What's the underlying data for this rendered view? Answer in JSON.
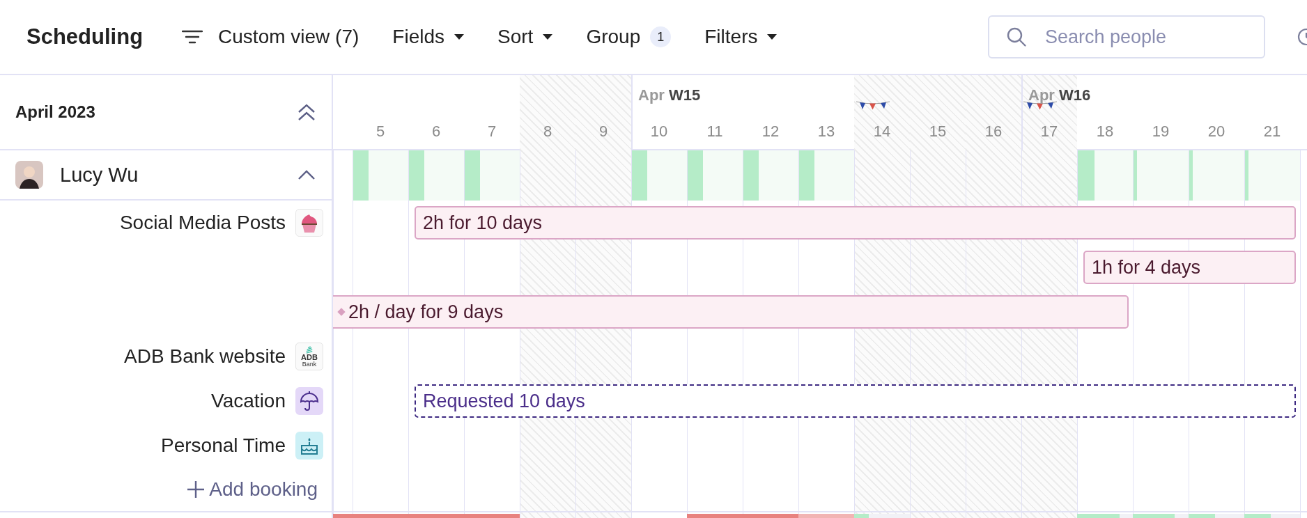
{
  "toolbar": {
    "title": "Scheduling",
    "view": {
      "label": "Custom view (7)"
    },
    "menus": [
      {
        "label": "Fields",
        "kind": "dropdown"
      },
      {
        "label": "Sort",
        "kind": "dropdown"
      },
      {
        "label": "Group",
        "kind": "count",
        "badge": "1"
      },
      {
        "label": "Filters",
        "kind": "dropdown"
      }
    ],
    "search": {
      "placeholder": "Search people"
    }
  },
  "sidebar": {
    "month": "April 2023",
    "person": {
      "name": "Lucy Wu",
      "expanded": true
    },
    "projects": [
      {
        "name": "Social Media Posts",
        "kind": "cupcake",
        "bookings": [
          {
            "label": "2h for 10 days",
            "kind": "confirmed",
            "continues_left": false
          },
          {
            "label": "1h for 4 days",
            "kind": "confirmed",
            "continues_left": false
          },
          {
            "label": "2h / day for 9 days",
            "kind": "confirmed",
            "continues_left": true
          }
        ]
      },
      {
        "name": "ADB Bank website",
        "kind": "logo",
        "logo_text": [
          "ADB",
          "Bank"
        ]
      },
      {
        "name": "Vacation",
        "kind": "umbrella",
        "bookings": [
          {
            "label": "Requested 10 days",
            "kind": "requested",
            "continues_left": false
          }
        ]
      },
      {
        "name": "Personal Time",
        "kind": "cake"
      }
    ],
    "add_label": "Add booking"
  },
  "weeks": [
    {
      "month": "Apr",
      "week": "W15"
    },
    {
      "month": "Apr",
      "week": "W16"
    }
  ],
  "days": [
    {
      "load": {
        "color": "#e8827f",
        "level": 1
      }
    },
    {
      "label": "5",
      "weekend": false,
      "level": 0.28,
      "load": {
        "color": "#e8827f",
        "level": 1
      }
    },
    {
      "label": "6",
      "weekend": false,
      "level": 0.28,
      "load": {
        "color": "#e8827f",
        "level": 1
      }
    },
    {
      "label": "7",
      "weekend": false,
      "level": 0.28,
      "load": {
        "color": "#e8827f",
        "level": 1
      }
    },
    {
      "label": "8",
      "weekend": true
    },
    {
      "label": "9",
      "weekend": true
    },
    {
      "label": "10",
      "weekend": false,
      "level": 0.28
    },
    {
      "label": "11",
      "weekend": false,
      "level": 0.28,
      "load": {
        "color": "#e8827f",
        "level": 1
      }
    },
    {
      "label": "12",
      "weekend": false,
      "level": 0.28,
      "load": {
        "color": "#e8827f",
        "level": 1
      }
    },
    {
      "label": "13",
      "weekend": false,
      "level": 0.28,
      "load": {
        "color": "#f2b4b3",
        "level": 1
      }
    },
    {
      "label": "14",
      "weekend": true,
      "holiday": true,
      "load": {
        "color": "#b5ecc8",
        "level": 0.26
      }
    },
    {
      "label": "15",
      "weekend": true
    },
    {
      "label": "16",
      "weekend": true
    },
    {
      "label": "17",
      "weekend": true,
      "holiday": true
    },
    {
      "label": "18",
      "weekend": false,
      "level": 0.3,
      "load": {
        "color": "#b5ecc8",
        "level": 0.76
      }
    },
    {
      "label": "19",
      "weekend": false,
      "level": 0.06,
      "load": {
        "color": "#b5ecc8",
        "level": 0.75
      }
    },
    {
      "label": "20",
      "weekend": false,
      "level": 0.06,
      "load": {
        "color": "#b5ecc8",
        "level": 0.48
      }
    },
    {
      "label": "21",
      "weekend": false,
      "level": 0.06,
      "load": {
        "color": "#b5ecc8",
        "level": 0.47
      }
    }
  ]
}
